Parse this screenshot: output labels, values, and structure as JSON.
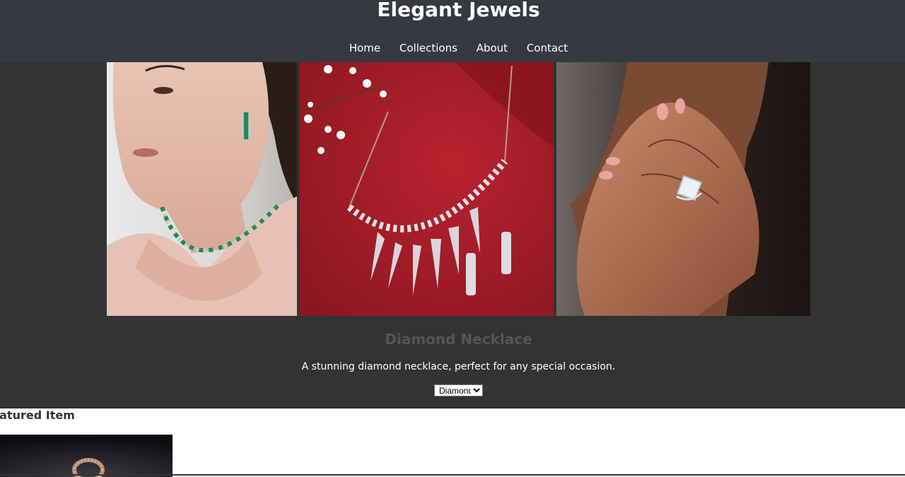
{
  "header": {
    "title": "Elegant Jewels",
    "nav": [
      "Home",
      "Collections",
      "About",
      "Contact"
    ]
  },
  "gallery": {
    "images": [
      {
        "icon": "model-emerald-necklace-photo"
      },
      {
        "icon": "diamond-necklace-on-red-photo"
      },
      {
        "icon": "diamond-ring-on-hand-photo"
      }
    ]
  },
  "item": {
    "title": "Diamond Necklace",
    "description": "A stunning diamond necklace, perfect for any special occasion.",
    "select_value": "Diamond"
  },
  "featured": {
    "heading": "Featured Item"
  },
  "colors": {
    "header_bg": "#343a40",
    "section_bg": "#333333",
    "title_muted": "#555555"
  }
}
